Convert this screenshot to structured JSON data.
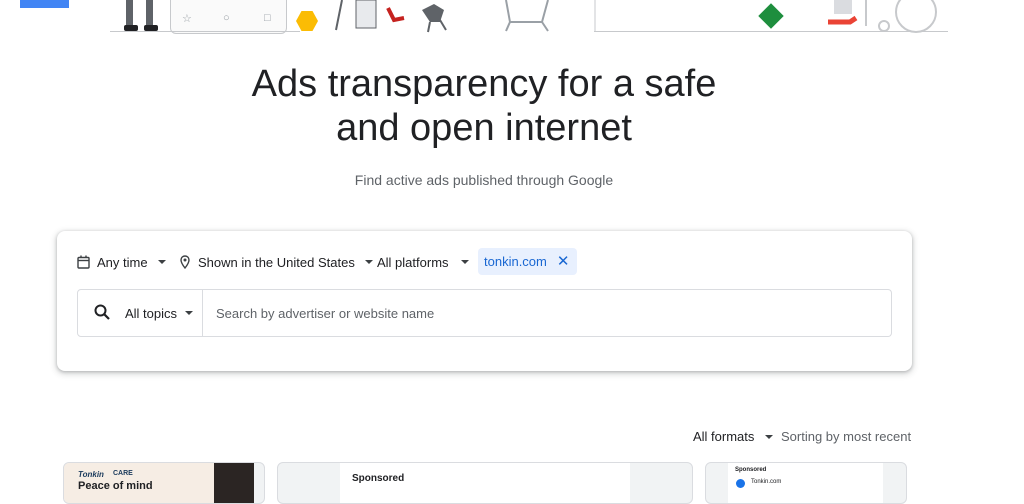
{
  "hero": {
    "title_line1": "Ads transparency for a safe",
    "title_line2": "and open internet",
    "subtitle": "Find active ads published through Google"
  },
  "filters": {
    "time": "Any time",
    "region": "Shown in the United States",
    "platforms": "All platforms",
    "chip": "tonkin.com"
  },
  "search": {
    "topics": "All topics",
    "placeholder": "Search by advertiser or website name",
    "value": ""
  },
  "results": {
    "formats": "All formats",
    "sorting": "Sorting by most recent"
  },
  "ads": [
    {
      "brand": "Tonkin",
      "care": "CARE",
      "headline": "Peace of mind"
    },
    {
      "sponsored": "Sponsored"
    },
    {
      "sponsored": "Sponsored",
      "domain": "Tonkin.com"
    }
  ],
  "colors": {
    "accent_blue": "#4285f4",
    "chip_bg": "#e8f0fe",
    "chip_text": "#1967d2",
    "yellow": "#fbbc04",
    "green": "#1e8e3e"
  }
}
